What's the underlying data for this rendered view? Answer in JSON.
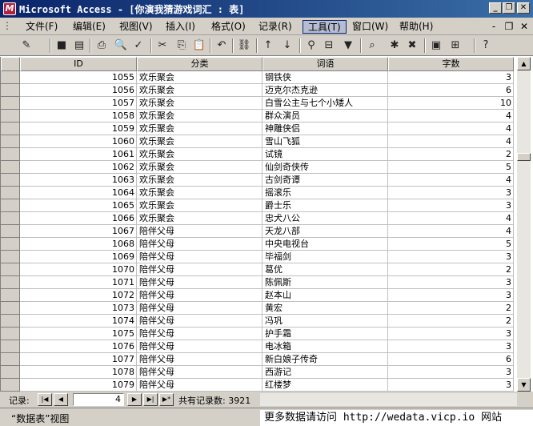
{
  "window": {
    "title": "Microsoft Access - [你演我猜游戏词汇 : 表]",
    "app_icon_letter": "M",
    "minimize_glyph": "_",
    "restore_glyph": "❐",
    "close_glyph": "✕"
  },
  "menu": {
    "items": [
      {
        "label": "文件(F)"
      },
      {
        "label": "编辑(E)"
      },
      {
        "label": "视图(V)"
      },
      {
        "label": "插入(I)"
      },
      {
        "label": "格式(O)"
      },
      {
        "label": "记录(R)"
      },
      {
        "label": "工具(T)",
        "active": true
      },
      {
        "label": "窗口(W)"
      },
      {
        "label": "帮助(H)"
      }
    ],
    "minimize_glyph": "-",
    "restore_glyph": "❐",
    "close_glyph": "✕"
  },
  "toolbar": {
    "icons": [
      {
        "name": "view-icon",
        "glyph": "✎"
      },
      {
        "name": "save-icon",
        "glyph": "■"
      },
      {
        "name": "search-file-icon",
        "glyph": "▤"
      },
      {
        "name": "print-icon",
        "glyph": "⎙"
      },
      {
        "name": "print-preview-icon",
        "glyph": "🔍"
      },
      {
        "name": "spelling-icon",
        "glyph": "✓"
      },
      {
        "name": "cut-icon",
        "glyph": "✂"
      },
      {
        "name": "copy-icon",
        "glyph": "⎘"
      },
      {
        "name": "paste-icon",
        "glyph": "📋"
      },
      {
        "name": "undo-icon",
        "glyph": "↶"
      },
      {
        "name": "hyperlink-icon",
        "glyph": "⛓"
      },
      {
        "name": "sort-ascending-icon",
        "glyph": "↑"
      },
      {
        "name": "sort-descending-icon",
        "glyph": "↓"
      },
      {
        "name": "filter-by-selection-icon",
        "glyph": "⚲"
      },
      {
        "name": "filter-by-form-icon",
        "glyph": "⊟"
      },
      {
        "name": "apply-filter-icon",
        "glyph": "▼"
      },
      {
        "name": "find-icon",
        "glyph": "⌕"
      },
      {
        "name": "new-record-icon",
        "glyph": "✱"
      },
      {
        "name": "delete-record-icon",
        "glyph": "✖"
      },
      {
        "name": "database-window-icon",
        "glyph": "▣"
      },
      {
        "name": "new-object-icon",
        "glyph": "⊞"
      },
      {
        "name": "help-icon",
        "glyph": "?"
      }
    ]
  },
  "table": {
    "columns": [
      "ID",
      "分类",
      "词语",
      "字数"
    ],
    "rows": [
      {
        "id": "1055",
        "category": "欢乐聚会",
        "word": "钢铁侠",
        "length": "3"
      },
      {
        "id": "1056",
        "category": "欢乐聚会",
        "word": "迈克尔杰克逊",
        "length": "6"
      },
      {
        "id": "1057",
        "category": "欢乐聚会",
        "word": "白雪公主与七个小矮人",
        "length": "10"
      },
      {
        "id": "1058",
        "category": "欢乐聚会",
        "word": "群众演员",
        "length": "4"
      },
      {
        "id": "1059",
        "category": "欢乐聚会",
        "word": "神雕侠侣",
        "length": "4"
      },
      {
        "id": "1060",
        "category": "欢乐聚会",
        "word": "雪山飞狐",
        "length": "4"
      },
      {
        "id": "1061",
        "category": "欢乐聚会",
        "word": "试镜",
        "length": "2"
      },
      {
        "id": "1062",
        "category": "欢乐聚会",
        "word": "仙剑奇侠传",
        "length": "5"
      },
      {
        "id": "1063",
        "category": "欢乐聚会",
        "word": "古剑奇谭",
        "length": "4"
      },
      {
        "id": "1064",
        "category": "欢乐聚会",
        "word": "摇滚乐",
        "length": "3"
      },
      {
        "id": "1065",
        "category": "欢乐聚会",
        "word": "爵士乐",
        "length": "3"
      },
      {
        "id": "1066",
        "category": "欢乐聚会",
        "word": "忠犬八公",
        "length": "4"
      },
      {
        "id": "1067",
        "category": "陪伴父母",
        "word": "天龙八部",
        "length": "4"
      },
      {
        "id": "1068",
        "category": "陪伴父母",
        "word": "中央电视台",
        "length": "5"
      },
      {
        "id": "1069",
        "category": "陪伴父母",
        "word": "毕福剑",
        "length": "3"
      },
      {
        "id": "1070",
        "category": "陪伴父母",
        "word": "葛优",
        "length": "2"
      },
      {
        "id": "1071",
        "category": "陪伴父母",
        "word": "陈佩斯",
        "length": "3"
      },
      {
        "id": "1072",
        "category": "陪伴父母",
        "word": "赵本山",
        "length": "3"
      },
      {
        "id": "1073",
        "category": "陪伴父母",
        "word": "黄宏",
        "length": "2"
      },
      {
        "id": "1074",
        "category": "陪伴父母",
        "word": "冯巩",
        "length": "2"
      },
      {
        "id": "1075",
        "category": "陪伴父母",
        "word": "护手霜",
        "length": "3"
      },
      {
        "id": "1076",
        "category": "陪伴父母",
        "word": "电冰箱",
        "length": "3"
      },
      {
        "id": "1077",
        "category": "陪伴父母",
        "word": "新白娘子传奇",
        "length": "6"
      },
      {
        "id": "1078",
        "category": "陪伴父母",
        "word": "西游记",
        "length": "3"
      },
      {
        "id": "1079",
        "category": "陪伴父母",
        "word": "红楼梦",
        "length": "3"
      }
    ]
  },
  "navigation": {
    "record_label": "记录:",
    "current_record": "4",
    "total_label": "共有记录数: 3921",
    "first_glyph": "|◀",
    "prev_glyph": "◀",
    "next_glyph": "▶",
    "last_glyph": "▶|",
    "new_glyph": "▶*"
  },
  "status": {
    "view_text": "“数据表”视图",
    "watermark": "更多数据请访问 http://wedata.vicp.io 网站"
  },
  "colors": {
    "title_start": "#0a246a",
    "title_end": "#3a6ea5",
    "chrome": "#d4d0c8"
  }
}
